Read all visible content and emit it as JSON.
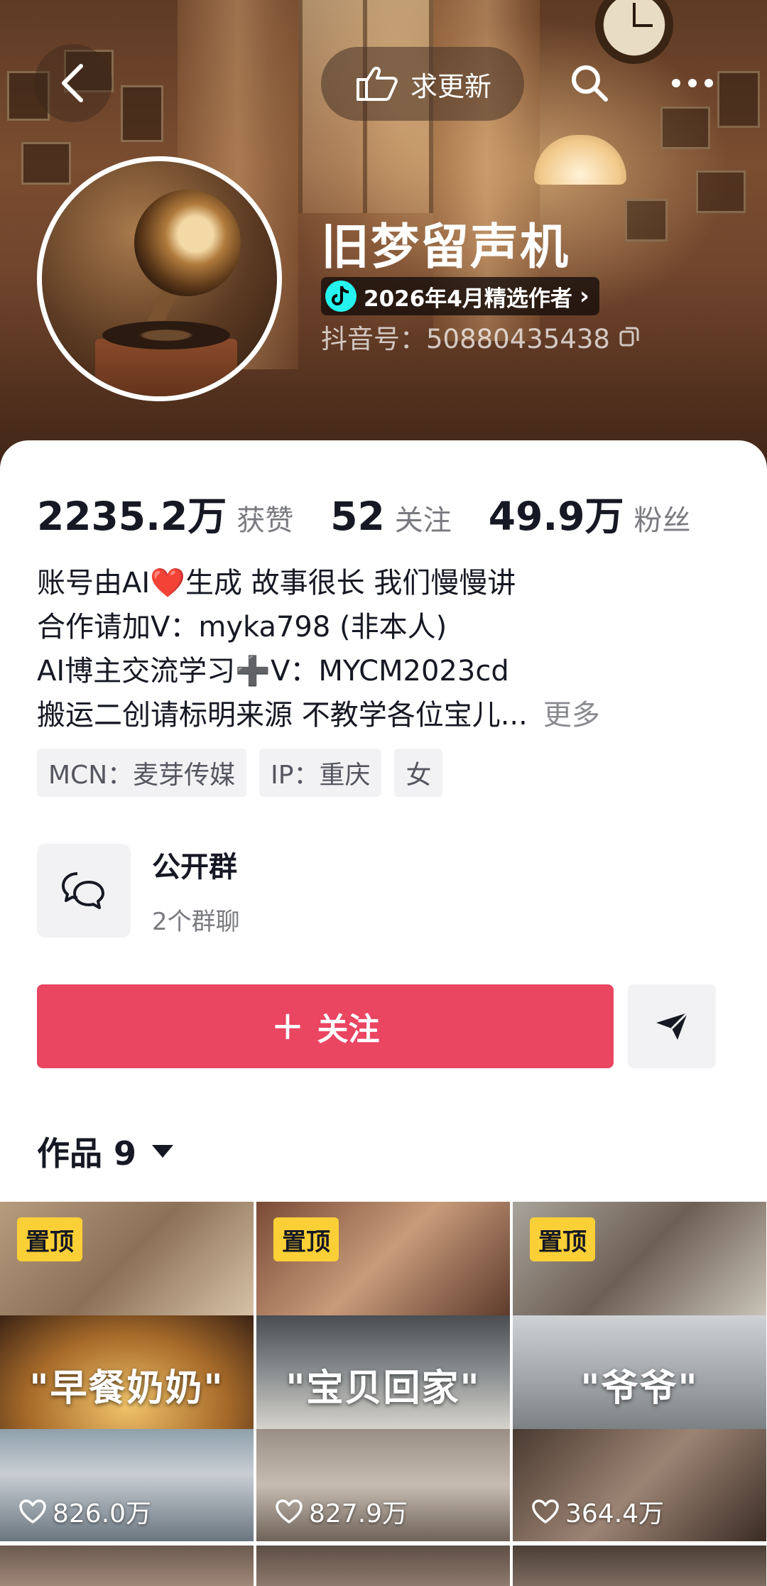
{
  "header": {
    "update_label": "求更新",
    "name": "旧梦留声机",
    "badge_label": "2026年4月精选作者",
    "douyin_id": "抖音号：50880435438"
  },
  "stats": [
    {
      "value": "2235.2万",
      "label": "获赞"
    },
    {
      "value": "52",
      "label": "关注"
    },
    {
      "value": "49.9万",
      "label": "粉丝"
    }
  ],
  "bio": {
    "lines": [
      "账号由AI❤️生成 故事很长 我们慢慢讲",
      "合作请加V：myka798 (非本人)",
      "AI博主交流学习➕V：MYCM2023cd",
      "搬运二创请标明来源  不教学各位宝儿..."
    ],
    "more_label": "更多"
  },
  "tags": [
    "MCN：麦芽传媒",
    "IP：重庆",
    "女"
  ],
  "group": {
    "title": "公开群",
    "subtitle": "2个群聊"
  },
  "follow": {
    "plus": "+",
    "label": "关注"
  },
  "works": {
    "title": "作品 9"
  },
  "videos": [
    {
      "pin_label": "置顶",
      "caption": "\"早餐奶奶\"",
      "likes": "826.0万"
    },
    {
      "pin_label": "置顶",
      "caption": "\"宝贝回家\"",
      "likes": "827.9万"
    },
    {
      "pin_label": "置顶",
      "caption": "\"爷爷\"",
      "likes": "364.4万"
    }
  ],
  "colors": {
    "follow_button": "#ea4561",
    "pin_badge": "#fbd036",
    "douyin_badge_accent": "#25f4ee"
  },
  "icons": [
    "back-icon",
    "hand-point-icon",
    "search-icon",
    "more-icon",
    "douyin-logo-icon",
    "copy-icon",
    "group-chat-icon",
    "share-send-icon",
    "heart-icon"
  ]
}
